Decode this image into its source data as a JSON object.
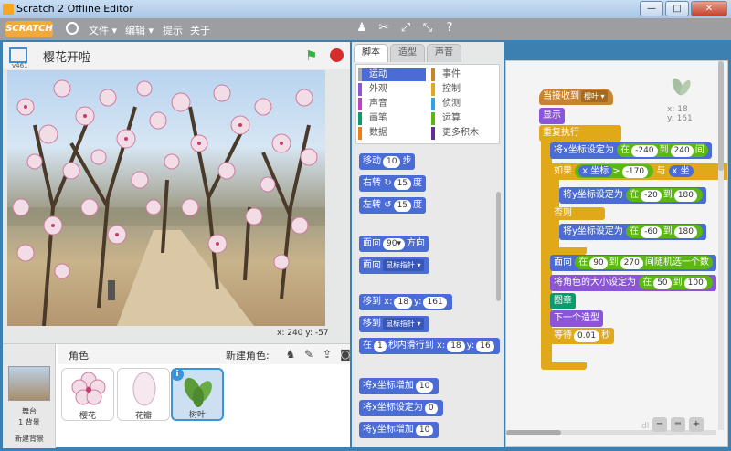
{
  "window": {
    "title": "Scratch 2 Offline Editor",
    "minimize": "—",
    "maximize": "□",
    "close": "✕"
  },
  "menu": {
    "logo": "SCRATCH",
    "items": [
      "文件 ▾",
      "编辑 ▾",
      "提示",
      "关于"
    ]
  },
  "toolbar": {
    "icons": [
      "duplicate-icon",
      "cut-icon",
      "grow-icon",
      "shrink-icon",
      "help-icon"
    ]
  },
  "stage": {
    "version": "v461",
    "project_title": "樱花开啦",
    "mouse_x_label": "x: 240",
    "mouse_y_label": "y: -57"
  },
  "sprites": {
    "header": "角色",
    "new_sprite": "新建角色:",
    "stage_name": "舞台",
    "stage_bg_count": "1 背景",
    "new_backdrop": "新建背景",
    "items": [
      {
        "name": "樱花",
        "selected": false
      },
      {
        "name": "花瓣",
        "selected": false
      },
      {
        "name": "树叶",
        "selected": true
      }
    ]
  },
  "tabs": [
    "脚本",
    "造型",
    "声音"
  ],
  "categories": [
    {
      "label": "运动",
      "color": "#4a6cd4",
      "active": true
    },
    {
      "label": "事件",
      "color": "#c88330"
    },
    {
      "label": "外观",
      "color": "#8a55d7"
    },
    {
      "label": "控制",
      "color": "#e1a91a"
    },
    {
      "label": "声音",
      "color": "#bb42c3"
    },
    {
      "label": "侦测",
      "color": "#2ca5e2"
    },
    {
      "label": "画笔",
      "color": "#0e9a6c"
    },
    {
      "label": "运算",
      "color": "#5cb712"
    },
    {
      "label": "数据",
      "color": "#ee7d16"
    },
    {
      "label": "更多积木",
      "color": "#632d99"
    }
  ],
  "palette": {
    "move": {
      "a": "移动",
      "n": "10",
      "b": "步"
    },
    "turn_right": {
      "a": "右转",
      "icon": "↻",
      "n": "15",
      "b": "度"
    },
    "turn_left": {
      "a": "左转",
      "icon": "↺",
      "n": "15",
      "b": "度"
    },
    "point_dir": {
      "a": "面向",
      "n": "90▾",
      "b": "方向"
    },
    "point_towards": {
      "a": "面向",
      "drop": "鼠标指针 ▾"
    },
    "goto_xy": {
      "a": "移到 x:",
      "x": "18",
      "b": "y:",
      "y": "161"
    },
    "goto": {
      "a": "移到",
      "drop": "鼠标指针 ▾"
    },
    "glide": {
      "a": "在",
      "n": "1",
      "b": "秒内滑行到 x:",
      "x": "18",
      "c": "y:",
      "y": "16"
    },
    "change_x": {
      "a": "将x坐标增加",
      "n": "10"
    },
    "set_x": {
      "a": "将x坐标设定为",
      "n": "0"
    },
    "change_y": {
      "a": "将y坐标增加",
      "n": "10"
    }
  },
  "script": {
    "sprite_x": "x: 18",
    "sprite_y": "y: 161",
    "hat": {
      "a": "当接收到",
      "drop": "樱叶 ▾"
    },
    "show": "显示",
    "forever": "重复执行",
    "set_x": {
      "a": "将x坐标设定为",
      "b": "在",
      "n1": "-240",
      "c": "到",
      "n2": "240",
      "d": "间"
    },
    "if": {
      "a": "如果",
      "rep": "x 坐标",
      "op": ">",
      "n": "-170",
      "and": "与",
      "rep2": "x 坐"
    },
    "set_y1": {
      "a": "将y坐标设定为",
      "b": "在",
      "n1": "-20",
      "c": "到",
      "n2": "180"
    },
    "else": "否则",
    "set_y2": {
      "a": "将y坐标设定为",
      "b": "在",
      "n1": "-60",
      "c": "到",
      "n2": "180"
    },
    "point": {
      "a": "面向",
      "b": "在",
      "n1": "90",
      "c": "到",
      "n2": "270",
      "d": "间随机选一个数"
    },
    "size": {
      "a": "将角色的大小设定为",
      "b": "在",
      "n1": "50",
      "c": "到",
      "n2": "100"
    },
    "stamp": "图章",
    "next_costume": "下一个造型",
    "wait": {
      "a": "等待",
      "n": "0.01",
      "b": "秒"
    }
  },
  "watermark": "dl"
}
